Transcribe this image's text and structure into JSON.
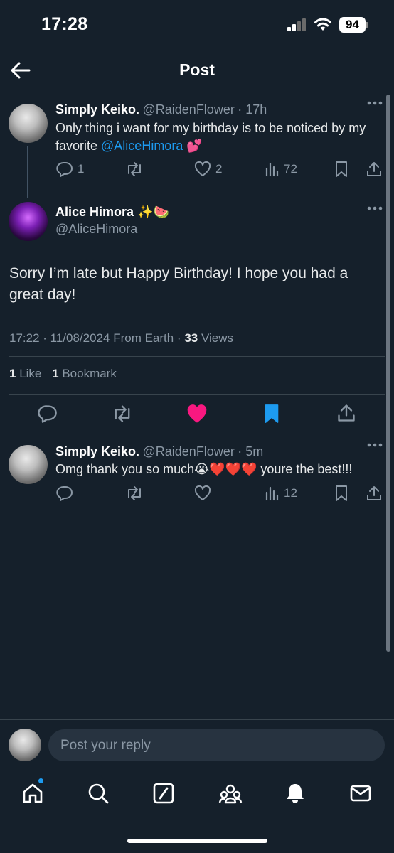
{
  "status_bar": {
    "time": "17:28",
    "battery": "94"
  },
  "header": {
    "title": "Post"
  },
  "parent_post": {
    "display_name": "Simply Keiko.",
    "handle": "@RaidenFlower",
    "time": "· 17h",
    "text_before": "Only thing i want for my birthday is to be noticed by my favorite ",
    "mention": "@AliceHimora",
    "text_after": " 💕",
    "replies": "1",
    "likes": "2",
    "views": "72"
  },
  "main_post": {
    "display_name": "Alice Himora ✨🍉",
    "handle": "@AliceHimora",
    "text": "Sorry I’m late but Happy Birthday! I hope you had a great day!",
    "meta_prefix": "17:22 · 11/08/2024 From Earth · ",
    "views_count": "33",
    "views_label": " Views",
    "likes_count": "1",
    "likes_label": " Like",
    "bookmarks_count": "1",
    "bookmarks_label": " Bookmark",
    "liked": true,
    "bookmarked": true
  },
  "reply_post": {
    "display_name": "Simply Keiko.",
    "handle": "@RaidenFlower",
    "time": "· 5m",
    "text": "Omg thank you so much😭❤️❤️❤️ youre the best!!!",
    "views": "12"
  },
  "reply_input": {
    "placeholder": "Post your reply"
  },
  "colors": {
    "background": "#15202b",
    "accent": "#1d9bf0",
    "like": "#f91880",
    "muted": "#8b98a5"
  },
  "icons": [
    "back-arrow-icon",
    "reply-icon",
    "repost-icon",
    "like-icon",
    "views-icon",
    "bookmark-icon",
    "share-icon",
    "more-icon",
    "home-icon",
    "search-icon",
    "grok-icon",
    "communities-icon",
    "notifications-icon",
    "messages-icon"
  ]
}
